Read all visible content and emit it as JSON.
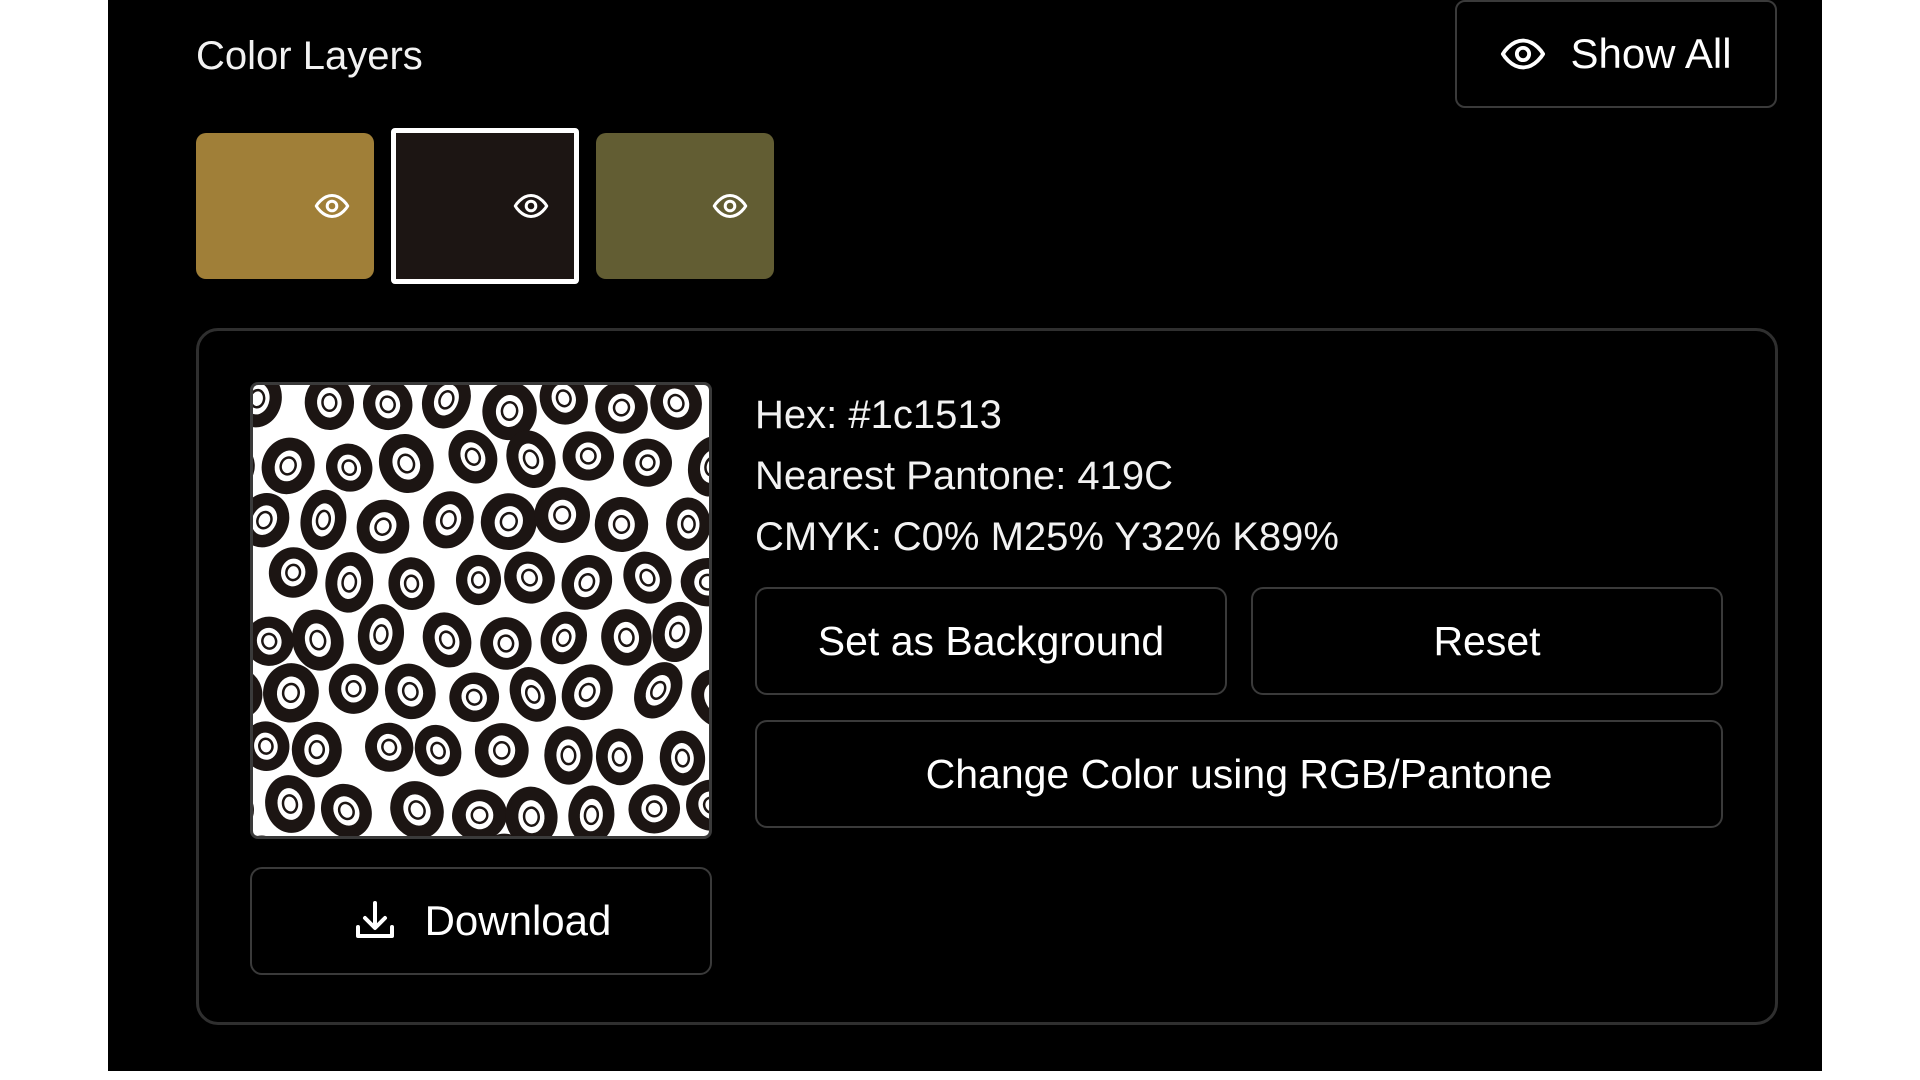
{
  "color_layers": {
    "title": "Color Layers",
    "show_all_label": "Show All",
    "swatches": [
      {
        "color": "#a07f38",
        "icon": "eye-icon",
        "selected": false
      },
      {
        "color": "#1c1513",
        "icon": "eye-icon",
        "selected": true
      },
      {
        "color": "#625d33",
        "icon": "eye-icon",
        "selected": false
      }
    ]
  },
  "detail": {
    "hex_line": "Hex: #1c1513",
    "pantone_line": "Nearest Pantone: 419C",
    "cmyk_line": "CMYK: C0% M25% Y32% K89%",
    "set_background_label": "Set as Background",
    "reset_label": "Reset",
    "change_color_label": "Change Color using RGB/Pantone",
    "download_label": "Download",
    "preview_icon": "leopard-pattern-preview"
  }
}
